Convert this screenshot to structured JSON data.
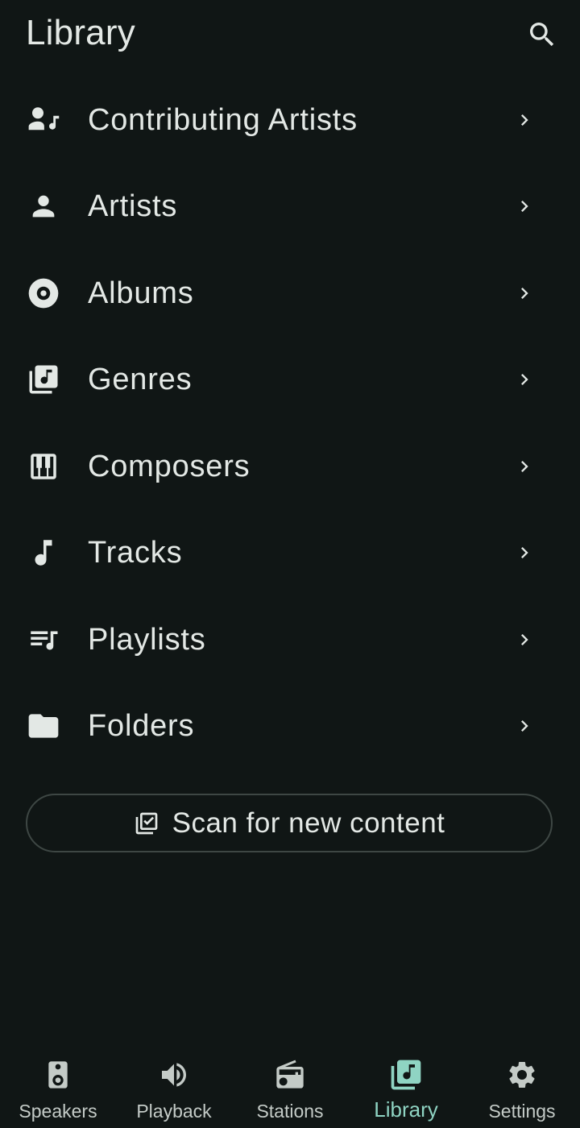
{
  "header": {
    "title": "Library",
    "search_icon": "search-icon"
  },
  "menu": {
    "items": [
      {
        "label": "Contributing Artists",
        "icon": "contributing-artists-icon"
      },
      {
        "label": "Artists",
        "icon": "person-icon"
      },
      {
        "label": "Albums",
        "icon": "album-icon"
      },
      {
        "label": "Genres",
        "icon": "library-music-icon"
      },
      {
        "label": "Composers",
        "icon": "piano-icon"
      },
      {
        "label": "Tracks",
        "icon": "music-note-icon"
      },
      {
        "label": "Playlists",
        "icon": "playlist-icon"
      },
      {
        "label": "Folders",
        "icon": "folder-icon"
      }
    ]
  },
  "scan": {
    "label": "Scan for new content",
    "icon": "library-add-check-icon"
  },
  "bottom_nav": {
    "items": [
      {
        "label": "Speakers",
        "icon": "speaker-icon",
        "active": false
      },
      {
        "label": "Playback",
        "icon": "volume-icon",
        "active": false
      },
      {
        "label": "Stations",
        "icon": "radio-icon",
        "active": false
      },
      {
        "label": "Library",
        "icon": "library-music-icon",
        "active": true
      },
      {
        "label": "Settings",
        "icon": "gear-icon",
        "active": false
      }
    ]
  },
  "colors": {
    "background": "#101615",
    "text": "#e3e8e5",
    "accent": "#8fd4c3",
    "outline": "#3e4744"
  }
}
